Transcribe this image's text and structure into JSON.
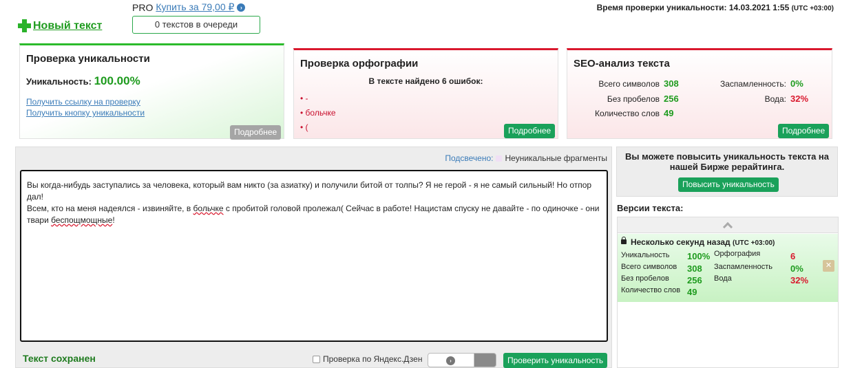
{
  "header": {
    "new_text": "Новый текст",
    "pro_label": "PRO",
    "pro_link": "Купить за 79,00 ₽",
    "queue": "0 текстов в очереди",
    "check_time_label": "Время проверки уникальности: 14.03.2021 1:55",
    "check_time_tz": "(UTC +03:00)"
  },
  "uniqueness_panel": {
    "title": "Проверка уникальности",
    "label": "Уникальность:",
    "value": "100.00%",
    "link1": "Получить ссылку на проверку",
    "link2": "Получить кнопку уникальности",
    "more": "Подробнее"
  },
  "spelling_panel": {
    "title": "Проверка орфографии",
    "subtitle": "В тексте найдено 6 ошибок:",
    "errors": [
      "• -",
      "• больчке",
      "• ("
    ],
    "more": "Подробнее"
  },
  "seo_panel": {
    "title": "SEO-анализ текста",
    "total_chars_label": "Всего символов",
    "total_chars": "308",
    "no_spaces_label": "Без пробелов",
    "no_spaces": "256",
    "words_label": "Количество слов",
    "words": "49",
    "spam_label": "Заспамленность:",
    "spam": "0%",
    "water_label": "Вода:",
    "water": "32%",
    "more": "Подробнее"
  },
  "editor": {
    "highlight_label": "Подсвечено:",
    "highlight_legend": "Неуникальные фрагменты",
    "line1": "Вы когда-нибудь заступались за человека, который вам никто (за азиатку) и получили битой от толпы? Я не герой - я не самый сильный! Но отпор дал!",
    "line2_a": "Всем, кто на меня надеялся - извиняйте, в ",
    "line2_misspelled": "больчке",
    "line2_b": " с пробитой головой пролежал( Сейчас в работе! Нацистам спуску не давайте - по одиночке - они твари ",
    "line2_misspelled2": "беспощмощные",
    "line2_c": "!",
    "saved": "Текст сохранен",
    "dzen": "Проверка по Яндекс.Дзен",
    "check_btn": "Проверить уникальность"
  },
  "sidebar": {
    "promo_text": "Вы можете повысить уникальность текста на нашей Бирже рерайтинга.",
    "promo_btn": "Повысить уникальность",
    "versions_title": "Версии текста:",
    "version": {
      "title": "Несколько секунд назад",
      "tz": "(UTC +03:00)",
      "uniq_label": "Уникальность",
      "uniq": "100%",
      "total_label": "Всего символов",
      "total": "308",
      "nospace_label": "Без пробелов",
      "nospace": "256",
      "words_label": "Количество слов",
      "words": "49",
      "orth_label": "Орфография",
      "orth": "6",
      "spam_label": "Заспамленность",
      "spam": "0%",
      "water_label": "Вода",
      "water": "32%"
    }
  }
}
